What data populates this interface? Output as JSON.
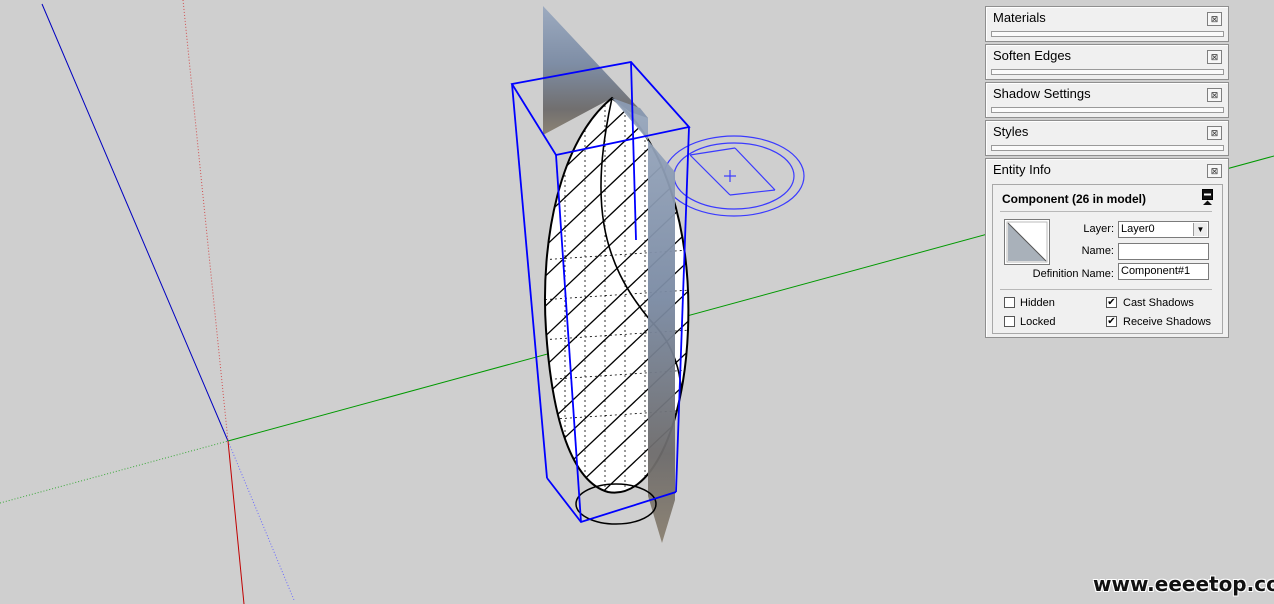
{
  "tray": {
    "panels": [
      {
        "title": "Materials"
      },
      {
        "title": "Soften Edges"
      },
      {
        "title": "Shadow Settings"
      },
      {
        "title": "Styles"
      }
    ],
    "entity_info": {
      "title": "Entity Info",
      "heading": "Component (26 in model)",
      "layer_label": "Layer:",
      "layer_value": "Layer0",
      "name_label": "Name:",
      "name_value": "",
      "definition_label": "Definition Name:",
      "definition_value": "Component#1",
      "options": {
        "hidden": {
          "label": "Hidden",
          "checked": false
        },
        "locked": {
          "label": "Locked",
          "checked": false
        },
        "cast_shadows": {
          "label": "Cast Shadows",
          "checked": true
        },
        "receive_shadows": {
          "label": "Receive Shadows",
          "checked": true
        }
      }
    },
    "close_glyph": "⊠"
  },
  "watermark": "www.eeeetop.com",
  "colors": {
    "background": "#cfcfcf",
    "axis_red": "#c00000",
    "axis_green": "#009900",
    "axis_blue": "#0000c0",
    "selection_blue": "#0000ff"
  },
  "icons": [
    "close-icon",
    "collapse-icon",
    "dropdown-arrow-icon",
    "checkmark-icon",
    "protractor-icon"
  ]
}
